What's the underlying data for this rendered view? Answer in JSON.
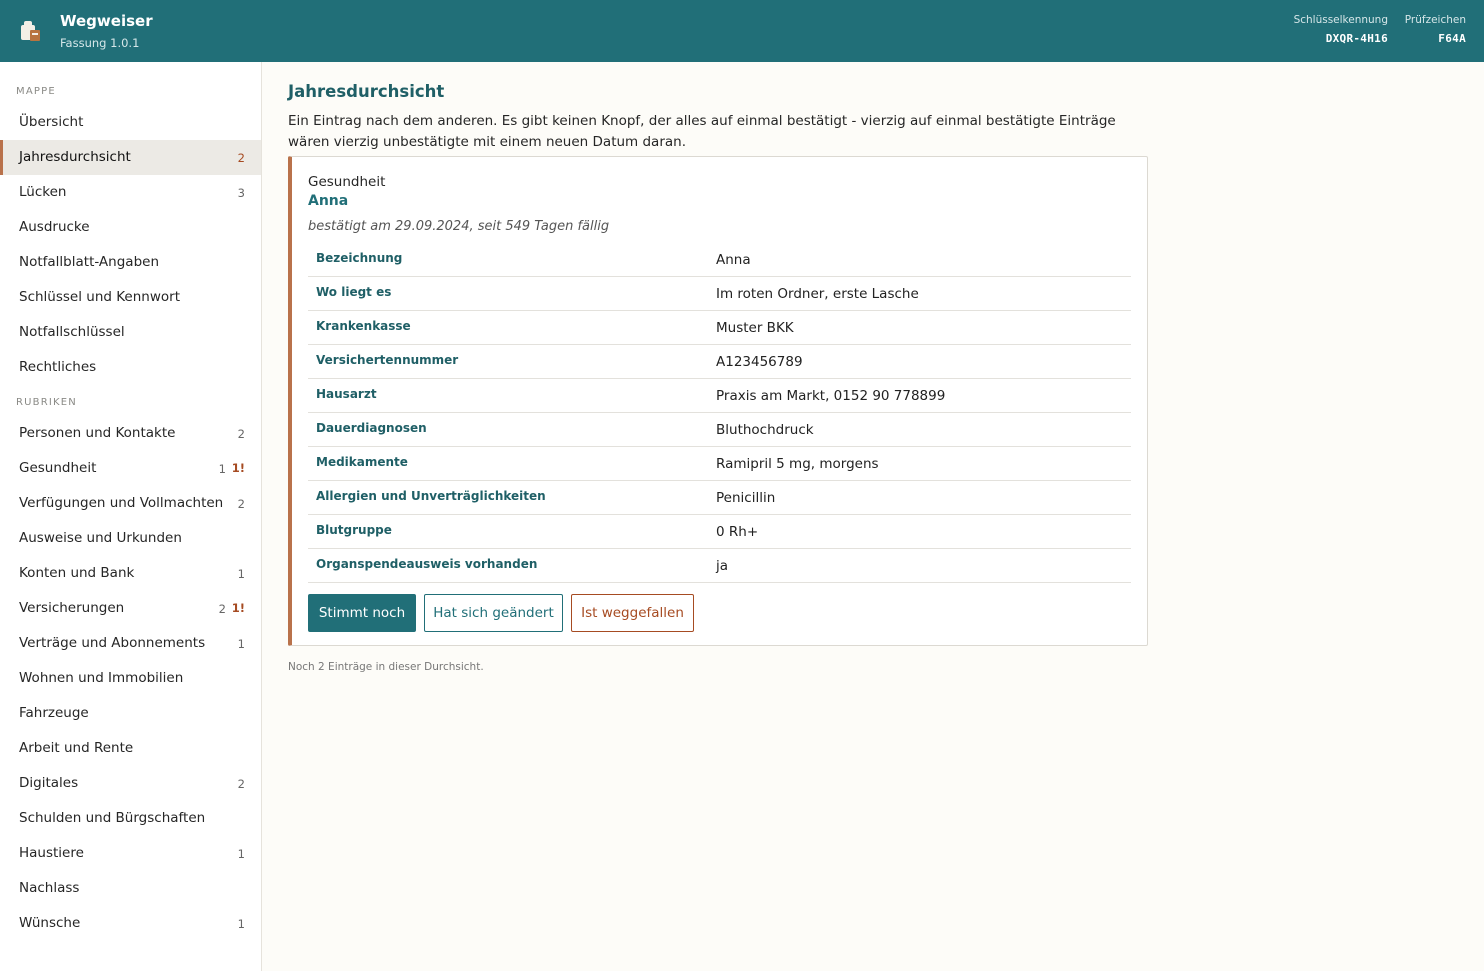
{
  "header": {
    "title": "Wegweiser",
    "version": "Fassung 1.0.1",
    "key_label": "Schlüsselkennung",
    "key_value": "DXQR-4H16",
    "check_label": "Prüfzeichen",
    "check_value": "F64A",
    "logo_icon": "folder-briefcase-icon"
  },
  "sidebar": {
    "section_mappe": "MAPPE",
    "section_rubriken": "RUBRIKEN",
    "mappe": [
      {
        "label": "Übersicht",
        "count": ""
      },
      {
        "label": "Jahresdurchsicht",
        "count": "2"
      },
      {
        "label": "Lücken",
        "count": "3"
      },
      {
        "label": "Ausdrucke",
        "count": ""
      },
      {
        "label": "Notfallblatt-Angaben",
        "count": ""
      },
      {
        "label": "Schlüssel und Kennwort",
        "count": ""
      },
      {
        "label": "Notfallschlüssel",
        "count": ""
      },
      {
        "label": "Rechtliches",
        "count": ""
      }
    ],
    "rubriken": [
      {
        "label": "Personen und Kontakte",
        "count": "2",
        "warn": ""
      },
      {
        "label": "Gesundheit",
        "count": "1",
        "warn": "1!"
      },
      {
        "label": "Verfügungen und Vollmachten",
        "count": "2",
        "warn": ""
      },
      {
        "label": "Ausweise und Urkunden",
        "count": "",
        "warn": ""
      },
      {
        "label": "Konten und Bank",
        "count": "1",
        "warn": ""
      },
      {
        "label": "Versicherungen",
        "count": "2",
        "warn": "1!"
      },
      {
        "label": "Verträge und Abonnements",
        "count": "1",
        "warn": ""
      },
      {
        "label": "Wohnen und Immobilien",
        "count": "",
        "warn": ""
      },
      {
        "label": "Fahrzeuge",
        "count": "",
        "warn": ""
      },
      {
        "label": "Arbeit und Rente",
        "count": "",
        "warn": ""
      },
      {
        "label": "Digitales",
        "count": "2",
        "warn": ""
      },
      {
        "label": "Schulden und Bürgschaften",
        "count": "",
        "warn": ""
      },
      {
        "label": "Haustiere",
        "count": "1",
        "warn": ""
      },
      {
        "label": "Nachlass",
        "count": "",
        "warn": ""
      },
      {
        "label": "Wünsche",
        "count": "1",
        "warn": ""
      }
    ],
    "active": "Jahresdurchsicht"
  },
  "main": {
    "title": "Jahresdurchsicht",
    "intro": "Ein Eintrag nach dem anderen. Es gibt keinen Knopf, der alles auf einmal bestätigt - vierzig auf einmal bestätigte Einträge wären vierzig unbestätigte mit einem neuen Datum daran.",
    "card": {
      "rubric": "Gesundheit",
      "name": "Anna",
      "status": "bestätigt am 29.09.2024, seit 549 Tagen fällig",
      "fields": [
        {
          "key": "Bezeichnung",
          "value": "Anna"
        },
        {
          "key": "Wo liegt es",
          "value": "Im roten Ordner, erste Lasche"
        },
        {
          "key": "Krankenkasse",
          "value": "Muster BKK"
        },
        {
          "key": "Versichertennummer",
          "value": "A123456789"
        },
        {
          "key": "Hausarzt",
          "value": "Praxis am Markt, 0152 90 778899"
        },
        {
          "key": "Dauerdiagnosen",
          "value": "Bluthochdruck"
        },
        {
          "key": "Medikamente",
          "value": "Ramipril 5 mg, morgens"
        },
        {
          "key": "Allergien und Unverträglichkeiten",
          "value": "Penicillin"
        },
        {
          "key": "Blutgruppe",
          "value": "0 Rh+"
        },
        {
          "key": "Organspendeausweis vorhanden",
          "value": "ja"
        }
      ],
      "btn_ok": "Stimmt noch",
      "btn_changed": "Hat sich geändert",
      "btn_gone": "Ist weggefallen"
    },
    "footer": "Noch 2 Einträge in dieser Durchsicht."
  },
  "colors": {
    "header_bg": "#216f78",
    "accent": "#b9724b",
    "warning": "#a64b22",
    "page_bg": "#fdfcf8"
  }
}
